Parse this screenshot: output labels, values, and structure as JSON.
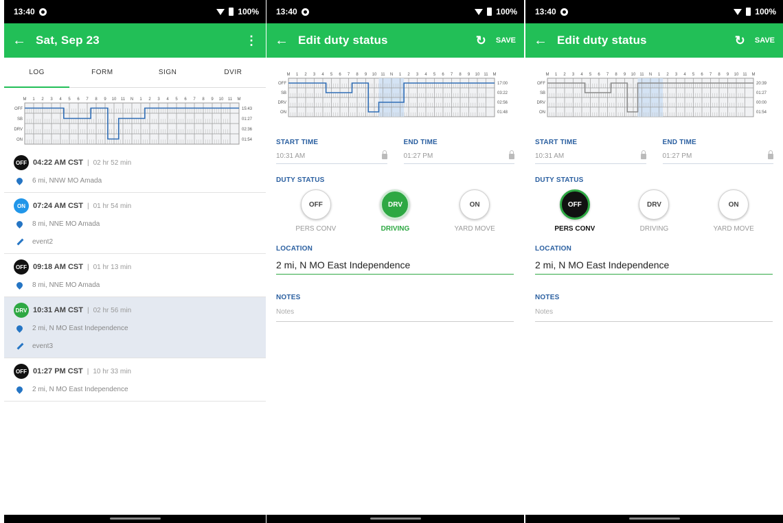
{
  "status_bar": {
    "time": "13:40",
    "battery": "100%"
  },
  "log_screen": {
    "title": "Sat, Sep 23",
    "tabs": [
      "LOG",
      "FORM",
      "SIGN",
      "DVIR"
    ],
    "chart": {
      "hour_labels": [
        "M",
        "1",
        "2",
        "3",
        "4",
        "5",
        "6",
        "7",
        "8",
        "9",
        "10",
        "11",
        "N",
        "1",
        "2",
        "3",
        "4",
        "5",
        "6",
        "7",
        "8",
        "9",
        "10",
        "11",
        "M"
      ],
      "status_labels": [
        "OFF",
        "SB",
        "DRV",
        "ON"
      ],
      "totals": [
        "15:43",
        "01:27",
        "02:36",
        "01:54"
      ]
    },
    "entries": [
      {
        "badge": "OFF",
        "time": "04:22 AM CST",
        "duration": "02 hr 52 min",
        "rows": [
          {
            "icon": "location-pin-icon",
            "text": "6 mi, NNW MO Amada"
          }
        ]
      },
      {
        "badge": "ON",
        "time": "07:24 AM CST",
        "duration": "01 hr 54 min",
        "rows": [
          {
            "icon": "location-pin-icon",
            "text": "8 mi, NNE MO Amada"
          },
          {
            "icon": "pencil-icon",
            "text": "event2"
          }
        ]
      },
      {
        "badge": "OFF",
        "time": "09:18 AM CST",
        "duration": "01 hr 13 min",
        "rows": [
          {
            "icon": "location-pin-icon",
            "text": "8 mi, NNE MO Amada"
          }
        ]
      },
      {
        "badge": "DRV",
        "time": "10:31 AM CST",
        "duration": "02 hr 56 min",
        "rows": [
          {
            "icon": "location-pin-icon",
            "text": "2 mi, N MO East Independence"
          },
          {
            "icon": "pencil-icon",
            "text": "event3"
          }
        ]
      },
      {
        "badge": "OFF",
        "time": "01:27 PM CST",
        "duration": "10 hr 33 min",
        "rows": [
          {
            "icon": "location-pin-icon",
            "text": "2 mi, N MO East Independence"
          }
        ]
      }
    ],
    "selected_entry": 3
  },
  "edit_screen_driving": {
    "title": "Edit duty status",
    "save_label": "SAVE",
    "chart": {
      "hour_labels": [
        "M",
        "1",
        "2",
        "3",
        "4",
        "5",
        "6",
        "7",
        "8",
        "9",
        "10",
        "11",
        "N",
        "1",
        "2",
        "3",
        "4",
        "5",
        "6",
        "7",
        "8",
        "9",
        "10",
        "11",
        "M"
      ],
      "status_labels": [
        "OFF",
        "SB",
        "DRV",
        "ON"
      ],
      "totals": [
        "17:00",
        "03:22",
        "02:56",
        "01:48"
      ]
    },
    "start_time_label": "START TIME",
    "start_time_value": "10:31 AM",
    "end_time_label": "END TIME",
    "end_time_value": "01:27 PM",
    "duty_status_label": "DUTY STATUS",
    "duty_options": [
      {
        "code": "OFF",
        "label": "PERS CONV"
      },
      {
        "code": "DRV",
        "label": "DRIVING"
      },
      {
        "code": "ON",
        "label": "YARD MOVE"
      }
    ],
    "selected_duty": "DRV",
    "location_label": "LOCATION",
    "location_value": "2 mi, N MO East Independence",
    "notes_label": "NOTES",
    "notes_placeholder": "Notes"
  },
  "edit_screen_persconv": {
    "title": "Edit duty status",
    "save_label": "SAVE",
    "chart": {
      "hour_labels": [
        "M",
        "1",
        "2",
        "3",
        "4",
        "5",
        "6",
        "7",
        "8",
        "9",
        "10",
        "11",
        "N",
        "1",
        "2",
        "3",
        "4",
        "5",
        "6",
        "7",
        "8",
        "9",
        "10",
        "11",
        "M"
      ],
      "status_labels": [
        "OFF",
        "SB",
        "DRV",
        "ON"
      ],
      "totals": [
        "20:39",
        "01:27",
        "00:00",
        "01:54"
      ]
    },
    "start_time_label": "START TIME",
    "start_time_value": "10:31 AM",
    "end_time_label": "END TIME",
    "end_time_value": "01:27 PM",
    "duty_status_label": "DUTY STATUS",
    "duty_options": [
      {
        "code": "OFF",
        "label": "PERS CONV"
      },
      {
        "code": "DRV",
        "label": "DRIVING"
      },
      {
        "code": "ON",
        "label": "YARD MOVE"
      }
    ],
    "selected_duty": "OFF",
    "location_label": "LOCATION",
    "location_value": "2 mi, N MO East Independence",
    "notes_label": "NOTES",
    "notes_placeholder": "Notes"
  },
  "colors": {
    "appbar": "#22bf57",
    "accent_blue": "#2575c4",
    "drv_green": "#2ea843",
    "on_blue": "#2196e9"
  }
}
